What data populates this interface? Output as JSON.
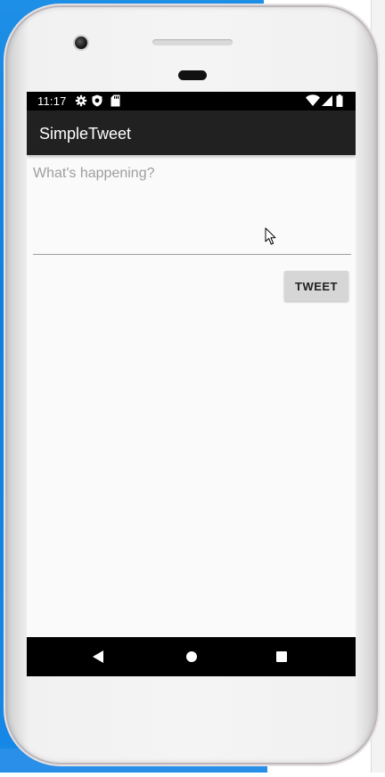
{
  "status_bar": {
    "time": "11:17",
    "left_icons": [
      "gear-icon",
      "shield-icon",
      "sd-card-icon"
    ],
    "right_icons": [
      "wifi-icon",
      "cell-signal-icon",
      "battery-icon"
    ]
  },
  "app_bar": {
    "title": "SimpleTweet",
    "background": "#212121"
  },
  "compose": {
    "input_value": "",
    "input_placeholder": "What's happening?",
    "tweet_button_label": "TWEET"
  },
  "nav_bar": {
    "buttons": [
      "back-icon",
      "home-icon",
      "recents-icon"
    ]
  },
  "colors": {
    "screen_background": "#fafafa",
    "button_background": "#d6d6d6",
    "placeholder": "#9e9e9e"
  }
}
